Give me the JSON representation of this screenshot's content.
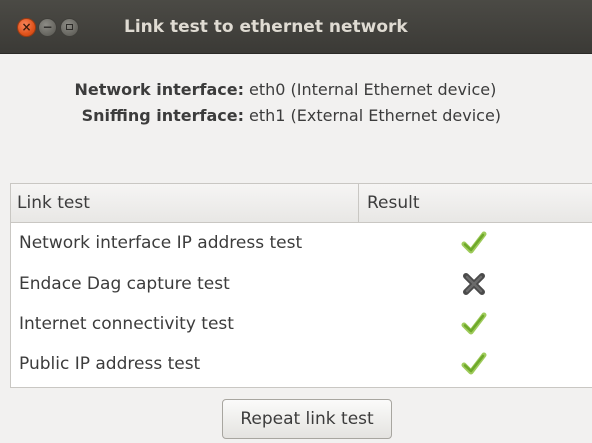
{
  "window": {
    "title": "Link test to ethernet network",
    "controls": {
      "close": "close-icon",
      "minimize": "minimize-icon",
      "maximize": "maximize-icon"
    }
  },
  "info": {
    "network_label": "Network interface:",
    "network_value": "eth0 (Internal Ethernet device)",
    "sniffing_label": "Sniffing interface:",
    "sniffing_value": "eth1 (External Ethernet device)"
  },
  "table": {
    "columns": [
      "Link test",
      "Result"
    ],
    "rows": [
      {
        "name": "Network interface IP address test",
        "result": "pass",
        "icon": "check-icon"
      },
      {
        "name": "Endace Dag capture test",
        "result": "fail",
        "icon": "cross-icon"
      },
      {
        "name": "Internet connectivity test",
        "result": "pass",
        "icon": "check-icon"
      },
      {
        "name": "Public IP address test",
        "result": "pass",
        "icon": "check-icon"
      }
    ]
  },
  "actions": {
    "repeat_label": "Repeat link test"
  },
  "colors": {
    "titlebar": "#3c3b37",
    "close_button": "#e2531b",
    "pass": "#7bb72b",
    "fail": "#555555"
  }
}
